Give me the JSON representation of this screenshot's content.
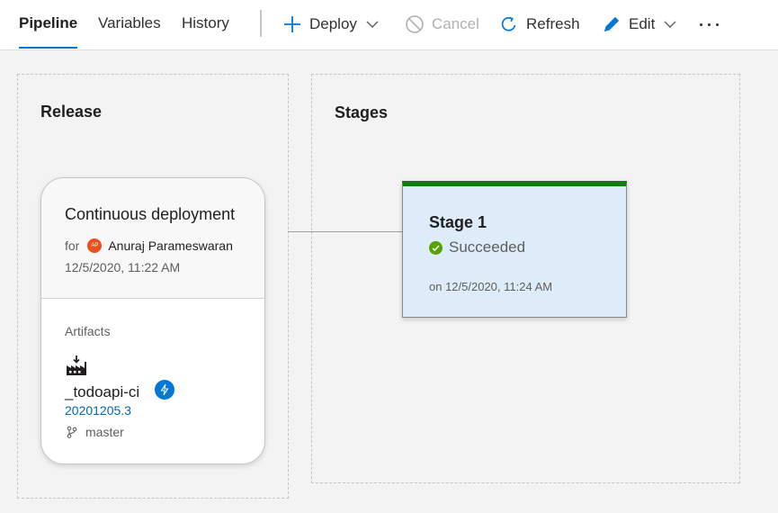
{
  "tabs": [
    {
      "label": "Pipeline",
      "active": true
    },
    {
      "label": "Variables",
      "active": false
    },
    {
      "label": "History",
      "active": false
    }
  ],
  "commands": {
    "deploy": "Deploy",
    "cancel": "Cancel",
    "refresh": "Refresh",
    "edit": "Edit"
  },
  "release_panel": {
    "title": "Release",
    "card": {
      "title": "Continuous deployment",
      "for_label": "for",
      "avatar_initials": "AP",
      "requester": "Anuraj Parameswaran",
      "date": "12/5/2020, 11:22 AM",
      "artifacts_label": "Artifacts",
      "artifact_name": "_todoapi-ci",
      "build": "20201205.3",
      "branch": "master"
    }
  },
  "stages_panel": {
    "title": "Stages",
    "stage": {
      "name": "Stage 1",
      "status": "Succeeded",
      "date": "on 12/5/2020, 11:24 AM"
    }
  },
  "colors": {
    "accent": "#0078d4",
    "success": "#107c10",
    "stage_bg": "#deecf9",
    "avatar": "#e8501f"
  },
  "icons": [
    "plus-icon",
    "chevron-down-icon",
    "cancel-icon",
    "refresh-icon",
    "edit-icon",
    "more-icon",
    "artifact-icon",
    "trigger-icon",
    "branch-icon",
    "success-icon"
  ]
}
